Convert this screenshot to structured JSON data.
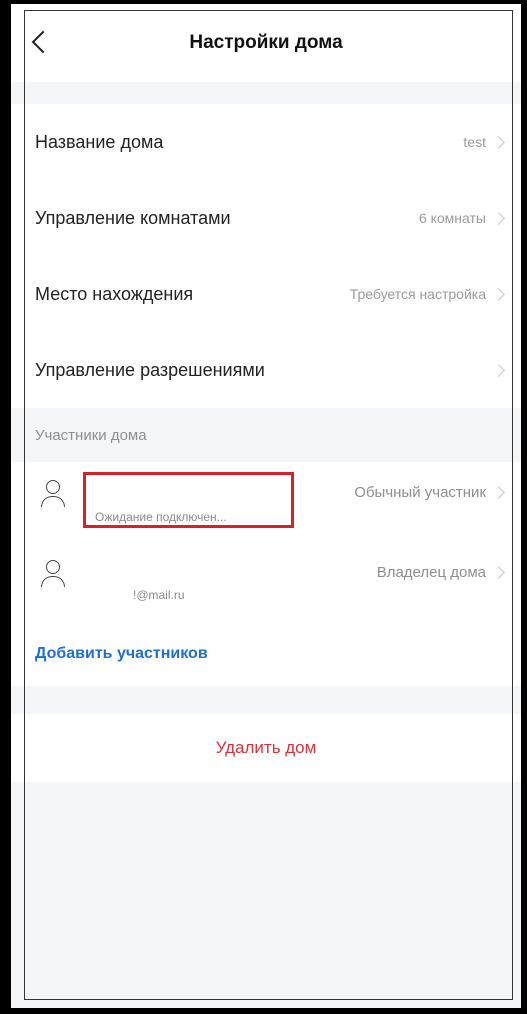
{
  "header": {
    "title": "Настройки дома"
  },
  "settings": {
    "items": [
      {
        "label": "Название дома",
        "value": "test"
      },
      {
        "label": "Управление комнатами",
        "value": "6 комнаты"
      },
      {
        "label": "Место нахождения",
        "value": "Требуется настройка"
      },
      {
        "label": "Управление разрешениями",
        "value": ""
      }
    ]
  },
  "members": {
    "section_title": "Участники дома",
    "list": [
      {
        "name": "Ожидание подключен...",
        "role": "Обычный участник"
      },
      {
        "name": "!@mail.ru",
        "role": "Владелец дома"
      }
    ],
    "add_label": "Добавить участников"
  },
  "actions": {
    "delete_label": "Удалить дом"
  },
  "colors": {
    "accent": "#1f6fd1",
    "danger": "#d6333a",
    "highlight": "#d6202a",
    "background": "#f4f5f7"
  }
}
